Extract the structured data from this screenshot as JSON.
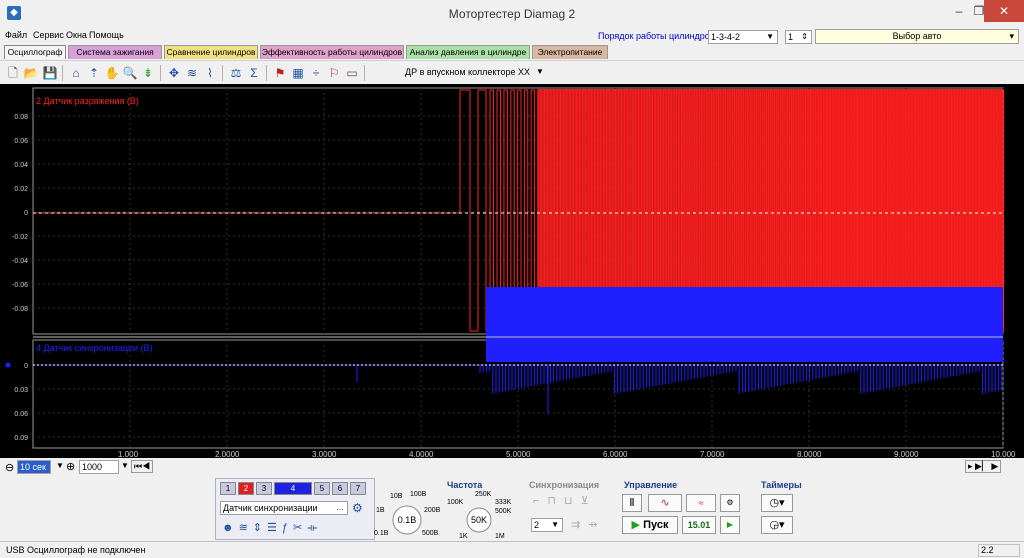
{
  "window": {
    "title": "Мотортестер Diamag 2"
  },
  "menu": [
    "Файл",
    "Сервис",
    "Окна",
    "Помощь"
  ],
  "cylinder_order": {
    "label": "Порядок работы цилиндров",
    "value": "1-3-4-2",
    "cylinder": "1"
  },
  "auto_select": "Выбор авто",
  "tabs": [
    {
      "label": "Осциллограф",
      "color": "#f4f4f4"
    },
    {
      "label": "Система зажигания",
      "color": "#d8a0d8"
    },
    {
      "label": "Сравнение цилиндров",
      "color": "#f0e080"
    },
    {
      "label": "Эффективность работы цилиндров",
      "color": "#e0a0c8"
    },
    {
      "label": "Анализ давления в цилиндре",
      "color": "#a8e0a8"
    },
    {
      "label": "Электропитание",
      "color": "#d8b8a0"
    }
  ],
  "toolbar": {
    "measurement": "ДР в впускном коллекторе ХХ"
  },
  "scope": {
    "channel2": {
      "label": "2 Датчик разряжения (В)",
      "color": "#ff2020",
      "ticks": [
        "0.08",
        "0.06",
        "0.04",
        "0.02",
        "0",
        "-0.02",
        "-0.04",
        "-0.06",
        "-0.08"
      ]
    },
    "channel4": {
      "label": "4 Датчик синхронизации (В)",
      "color": "#2020ff",
      "ticks": [
        "0",
        "0.03",
        "0.06",
        "0.09"
      ]
    },
    "time_ticks": [
      "1.000",
      "2.0000",
      "3.0000",
      "4.0000",
      "5.0000",
      "6.0000",
      "7.0000",
      "8.0000",
      "9.0000",
      "10.000"
    ]
  },
  "bottom": {
    "time_base": "10 сек",
    "points": "1000",
    "channels": [
      "1",
      "2",
      "3",
      "4",
      "5",
      "6",
      "7"
    ],
    "sensor": "Датчик синхронизации",
    "volt_range": {
      "value": "0.1В",
      "labels": [
        "10В",
        "100В",
        "200В",
        "500В",
        "0.1В",
        "1В"
      ]
    },
    "freq": {
      "title": "Частота",
      "value": "50K",
      "labels": [
        "250K",
        "100K",
        "333K",
        "500K",
        "1M",
        "1K"
      ]
    },
    "sync": {
      "title": "Синхронизация",
      "value": "2"
    },
    "control": {
      "title": "Управление",
      "start": "Пуск",
      "fps": "15.01"
    },
    "timers": {
      "title": "Таймеры"
    }
  },
  "status": {
    "text": "USB Осциллограф не подключен",
    "right": "2.2"
  }
}
